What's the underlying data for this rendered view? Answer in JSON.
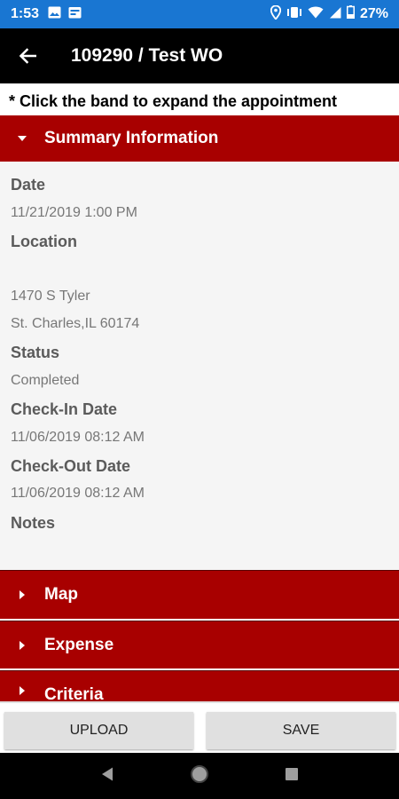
{
  "status_bar": {
    "time": "1:53",
    "battery": "27%"
  },
  "app_bar": {
    "title": "109290 / Test WO"
  },
  "hint": "* Click the band to expand the appointment",
  "sections": {
    "summary": "Summary Information",
    "map": "Map",
    "expense": "Expense",
    "criteria": "Criteria"
  },
  "summary": {
    "date_label": "Date",
    "date_value": "11/21/2019 1:00 PM",
    "location_label": "Location",
    "location_line1": "1470 S Tyler",
    "location_line2": "St. Charles,IL 60174",
    "status_label": "Status",
    "status_value": "Completed",
    "checkin_label": "Check-In Date",
    "checkin_value": "11/06/2019 08:12 AM",
    "checkout_label": "Check-Out Date",
    "checkout_value": "11/06/2019 08:12 AM",
    "notes_label": "Notes"
  },
  "buttons": {
    "upload": "UPLOAD",
    "save": "SAVE"
  },
  "colors": {
    "status_bar": "#1976d2",
    "band": "#a80000",
    "app_bar": "#000000"
  }
}
